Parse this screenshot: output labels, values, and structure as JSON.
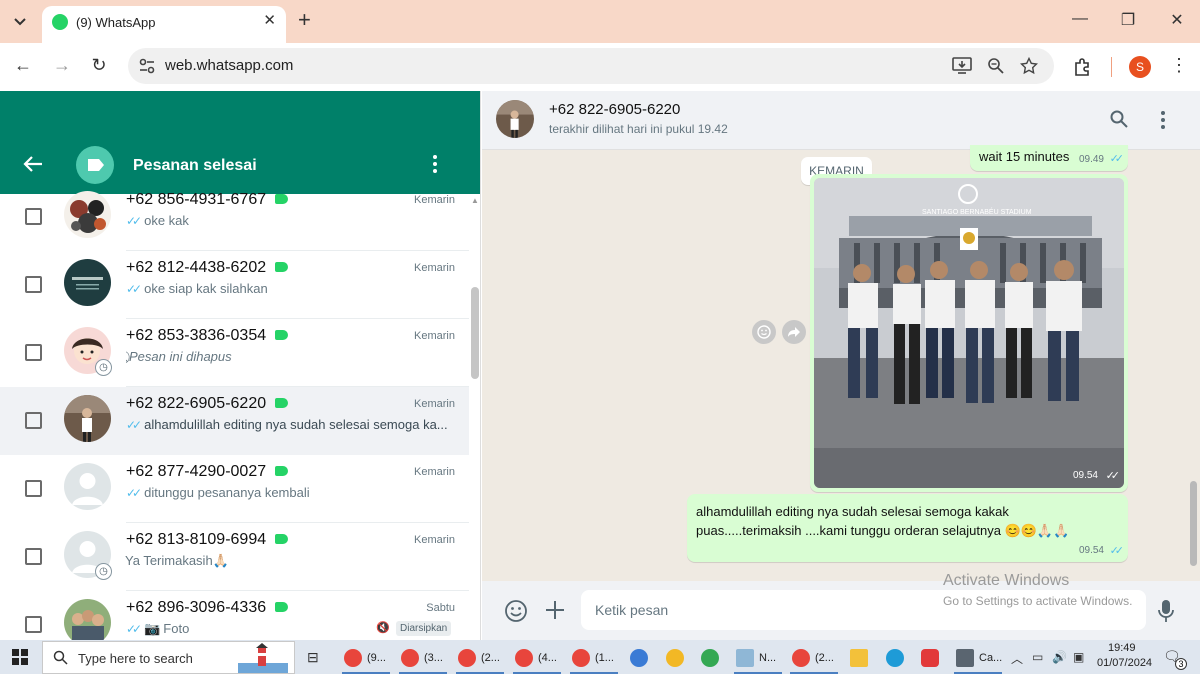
{
  "browser": {
    "tab_title": "(9) WhatsApp",
    "url": "web.whatsapp.com",
    "profile_initial": "S",
    "window_controls": [
      "minimize",
      "restore",
      "close"
    ]
  },
  "left_panel": {
    "title": "Pesanan selesai",
    "chats": [
      {
        "name": "+62 856-4931-6767",
        "time": "Kemarin",
        "message": "oke kak",
        "tick": true
      },
      {
        "name": "+62 812-4438-6202",
        "time": "Kemarin",
        "message": "oke siap kak silahkan",
        "tick": true
      },
      {
        "name": "+62 853-3836-0354",
        "time": "Kemarin",
        "message": "Pesan ini dihapus",
        "tick": false,
        "deleted": true
      },
      {
        "name": "+62 822-6905-6220",
        "time": "Kemarin",
        "message": "alhamdulillah editing nya sudah selesai semoga ka...",
        "tick": true,
        "selected": true
      },
      {
        "name": "+62 877-4290-0027",
        "time": "Kemarin",
        "message": "ditunggu pesananya kembali",
        "tick": true
      },
      {
        "name": "+62 813-8109-6994",
        "time": "Kemarin",
        "message": "Ya Terimakasih🙏🏻",
        "tick": false
      },
      {
        "name": "+62 896-3096-4336",
        "time": "Sabtu",
        "message": "Foto",
        "tick": true,
        "badge": "Diarsipkan"
      }
    ]
  },
  "chat": {
    "contact_name": "+62 822-6905-6220",
    "status": "terakhir dilihat hari ini pukul 19.42",
    "date_chip": "KEMARIN",
    "messages": [
      {
        "text": "wait 15 minutes",
        "time": "09.49"
      },
      {
        "type": "image",
        "time": "09.54",
        "photo_sign": "SANTIAGO BERNABÉU STADIUM"
      },
      {
        "text": "alhamdulillah editing nya sudah selesai semoga kakak puas.....terimaksih ....kami tunggu orderan selajutnya 😊😊🙏🏻🙏🏻",
        "time": "09.54"
      }
    ],
    "composer_placeholder": "Ketik pesan"
  },
  "watermark": {
    "title": "Activate Windows",
    "subtitle": "Go to Settings to activate Windows."
  },
  "taskbar": {
    "search_placeholder": "Type here to search",
    "items": [
      "(9...",
      "(3...",
      "(2...",
      "(4...",
      "(1...",
      "N...",
      "(2...",
      "Ca..."
    ],
    "time": "19:49",
    "date": "01/07/2024",
    "notification_count": "3"
  }
}
